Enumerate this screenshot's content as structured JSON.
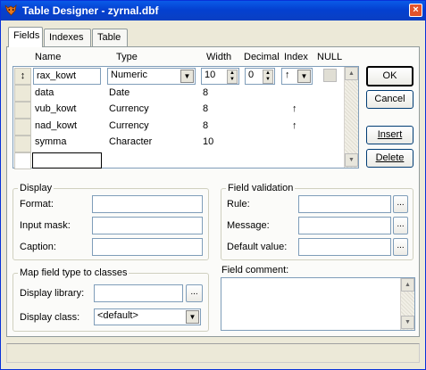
{
  "window": {
    "title": "Table Designer - zyrnal.dbf",
    "close_label": "×"
  },
  "tabs": [
    {
      "label": "Fields"
    },
    {
      "label": "Indexes"
    },
    {
      "label": "Table"
    }
  ],
  "grid": {
    "headers": {
      "name": "Name",
      "type": "Type",
      "width": "Width",
      "decimal": "Decimal",
      "index": "Index",
      "null": "NULL"
    },
    "rows": [
      {
        "name": "rax_kowt",
        "type": "Numeric",
        "width": "10",
        "decimal": "0",
        "index": "↑",
        "editing": true
      },
      {
        "name": "data",
        "type": "Date",
        "width": "8",
        "decimal": "",
        "index": ""
      },
      {
        "name": "vub_kowt",
        "type": "Currency",
        "width": "8",
        "decimal": "",
        "index": "↑"
      },
      {
        "name": "nad_kowt",
        "type": "Currency",
        "width": "8",
        "decimal": "",
        "index": "↑"
      },
      {
        "name": "symma",
        "type": "Character",
        "width": "10",
        "decimal": "",
        "index": ""
      },
      {
        "name": "",
        "type": "",
        "width": "",
        "decimal": "",
        "index": ""
      }
    ],
    "row_selector_glyph": "↕"
  },
  "buttons": {
    "ok": "OK",
    "cancel": "Cancel",
    "insert": "Insert",
    "delete": "Delete"
  },
  "display": {
    "group_label": "Display",
    "format_label": "Format:",
    "format_value": "",
    "input_mask_label": "Input mask:",
    "input_mask_value": "",
    "caption_label": "Caption:",
    "caption_value": ""
  },
  "validation": {
    "group_label": "Field validation",
    "rule_label": "Rule:",
    "rule_value": "",
    "message_label": "Message:",
    "message_value": "",
    "default_label": "Default value:",
    "default_value": "",
    "dots": "..."
  },
  "map": {
    "group_label": "Map field type to classes",
    "library_label": "Display library:",
    "library_value": "",
    "class_label": "Display class:",
    "class_value": "<default>",
    "dots": "..."
  },
  "comment": {
    "label": "Field comment:",
    "value": ""
  },
  "colors": {
    "title_blue": "#0a5be8",
    "face": "#ece9d8",
    "close_red": "#e2542d"
  }
}
